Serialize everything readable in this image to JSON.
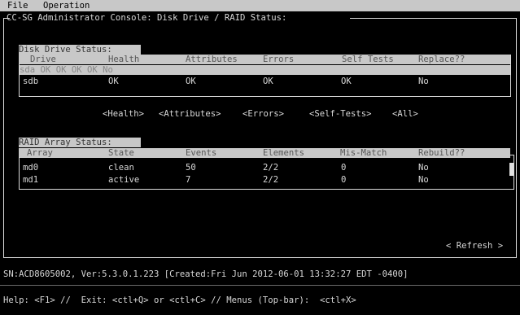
{
  "menu": {
    "file": "File",
    "operation": "Operation"
  },
  "console_title": "CC-SG Administrator Console: Disk Drive / RAID Status:",
  "disk": {
    "section_title": "Disk Drive Status:",
    "columns": [
      "Drive",
      "Health",
      "Attributes",
      "Errors",
      "Self Tests",
      "Replace??"
    ],
    "rows": [
      [
        "sda",
        "OK",
        "OK",
        "OK",
        "OK",
        "No"
      ],
      [
        "sdb",
        "OK",
        "OK",
        "OK",
        "OK",
        "No"
      ]
    ]
  },
  "actions": {
    "health": "<Health>",
    "attributes": "<Attributes>",
    "errors": "<Errors>",
    "self_tests": "<Self-Tests>",
    "all": "<All>"
  },
  "raid": {
    "section_title": "RAID Array Status:",
    "columns": [
      "Array",
      "State",
      "Events",
      "Elements",
      "Mis-Match",
      "Rebuild??"
    ],
    "rows": [
      [
        "md0",
        "clean",
        "50",
        "2/2",
        "0",
        "No"
      ],
      [
        "md1",
        "active",
        "7",
        "2/2",
        "0",
        "No"
      ]
    ]
  },
  "refresh": "< Refresh >",
  "status_line": "SN:ACD8605002, Ver:5.3.0.1.223 [Created:Fri Jun 2012-06-01 13:32:27 EDT -0400]",
  "help_line": "Help: <F1> //  Exit: <ctl+Q> or <ctl+C> // Menus (Top-bar):  <ctl+X>"
}
